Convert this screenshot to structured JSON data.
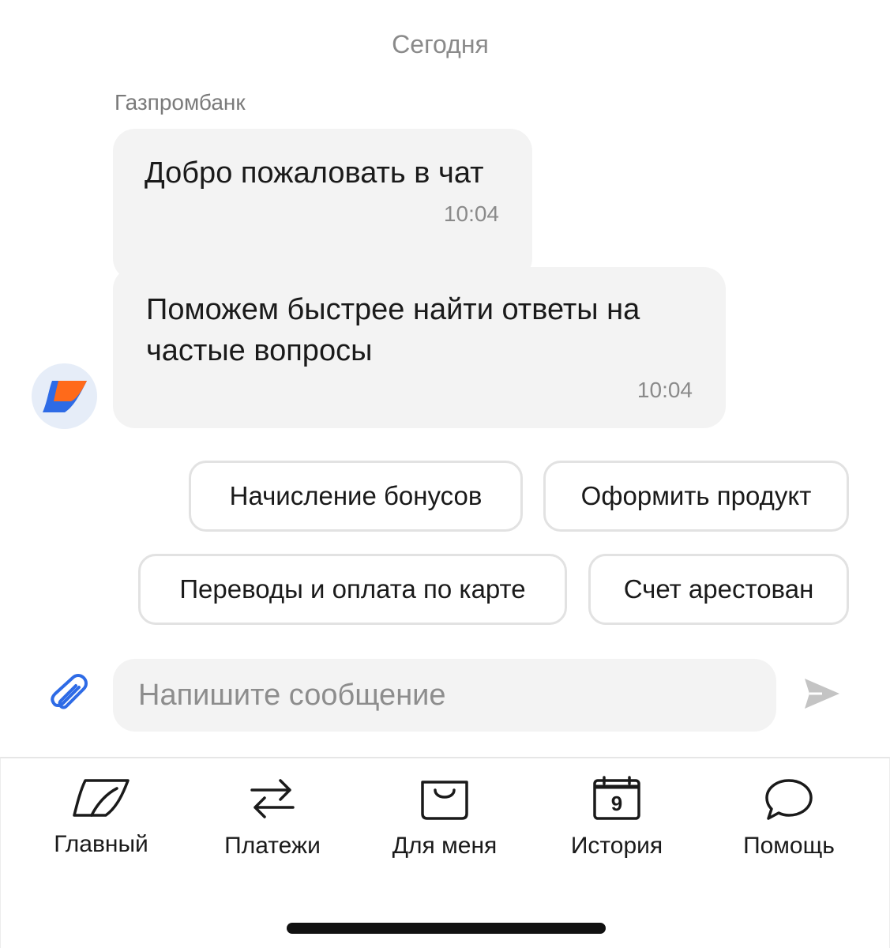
{
  "chat": {
    "date_label": "Сегодня",
    "sender": "Газпромбанк",
    "messages": [
      {
        "text": "Добро пожаловать в чат",
        "time": "10:04"
      },
      {
        "text": "Поможем быстрее найти ответы на частые вопросы",
        "time": "10:04"
      }
    ],
    "quick_replies": [
      "Начисление бонусов",
      "Оформить продукт",
      "Переводы и оплата по карте",
      "Счет арестован"
    ]
  },
  "composer": {
    "placeholder": "Напишите сообщение",
    "value": ""
  },
  "tabbar": {
    "items": [
      {
        "label": "Главный",
        "icon": "leaf-logo-icon"
      },
      {
        "label": "Платежи",
        "icon": "transfer-arrows-icon"
      },
      {
        "label": "Для меня",
        "icon": "shopping-bag-icon"
      },
      {
        "label": "История",
        "icon": "calendar-icon",
        "badge": "9"
      },
      {
        "label": "Помощь",
        "icon": "chat-bubble-icon"
      }
    ]
  },
  "colors": {
    "accent_blue": "#2e6be6",
    "accent_orange": "#ff6a1a",
    "bubble_bg": "#f3f3f3",
    "muted_text": "#8a8a8a"
  }
}
